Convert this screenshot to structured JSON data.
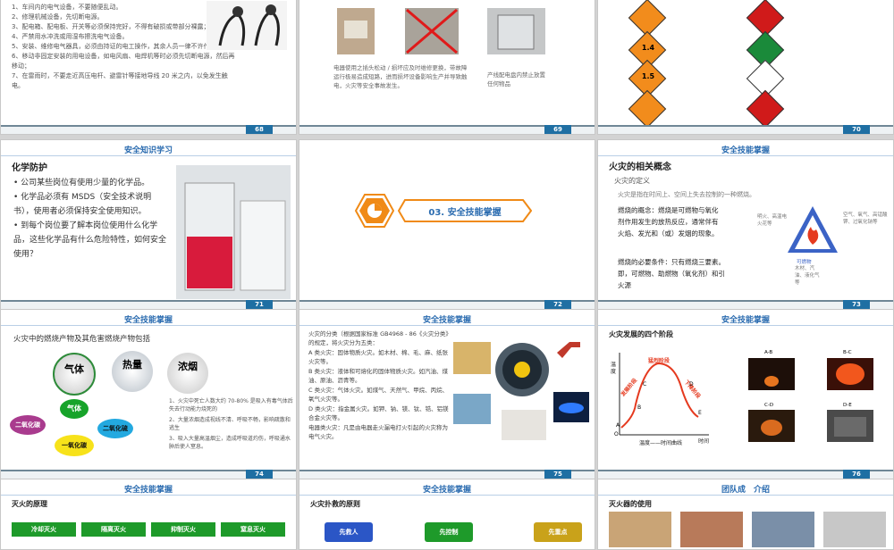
{
  "slide68": {
    "page": "68",
    "lines": [
      "1、车间内的电气设备，不要随便乱动。",
      "2、修理机械设备，先切断电源。",
      "3、配电箱、配电板、开关等必须保持完好，不得有破损或带部分裸露；",
      "4、严禁用水冲洗或用湿布擦洗电气设备。",
      "5、安装、维修电气器具，必须由持证的电工操作，其余人员一律不许作业。",
      "6、移动非固定安装的用电设备，如电风扇、电焊机等时必须先切断电源，然后再移动；",
      "7、在雷雨时，不要走近高压电杆、避雷针等接地导线 20 米之内，以免发生触电。"
    ]
  },
  "slide69": {
    "page": "69",
    "caption_left": "电器使用之插头松动 / 损坏应及时维修更换，带故障运行极易造成短路，进而损坏设备影响生产并导致触电，火灾等安全事故发生。",
    "caption_right": "产线配电盘内禁止放置任何物品"
  },
  "slide70": {
    "page": "70",
    "labels": [
      "1.4",
      "1.5",
      "1.6"
    ]
  },
  "slide71": {
    "page": "71",
    "header": "安全知识学习",
    "title": "化学防护",
    "bullets": [
      "公司某些岗位有使用少量的化学品。",
      "化学品必须有 MSDS（安全技术说明书），使用者必须保持安全使用知识。",
      "到每个岗位要了解本岗位使用什么化学品，这些化学品有什么危险特性，如何安全使用？"
    ]
  },
  "slide72": {
    "page": "72",
    "section": "03. 安全技能掌握"
  },
  "slide73": {
    "page": "73",
    "header": "安全技能掌握",
    "title": "火灾的相关概念",
    "subtitle": "火灾的定义",
    "def": "火灾是指在时间上、空间上失去控制的一种燃烧。",
    "concept": "燃烧的概念：燃烧是可燃物与氧化剂作用发生的放热反应，通常伴有火焰、发光和（或）发烟的现象。",
    "cond": "燃烧的必要条件：只有燃烧三要素。即，可燃物、助燃物（氧化剂）和引火源",
    "tri_left": "明火、高温电火花等",
    "tri_right": "空气、氧气、高锰酸钾、过氧化钠等",
    "tri_bottom": "可燃物",
    "tri_bottom2": "木材、汽油、液化气等"
  },
  "slide74": {
    "page": "74",
    "header": "安全技能掌握",
    "title": "火灾中的燃烧产物及其危害燃烧产物包括",
    "c1": "气体",
    "c2": "热量",
    "c3": "浓烟",
    "gas": "气体",
    "co2": "二氧化碳",
    "so2": "二氧化硫",
    "co": "一氧化碳",
    "notes": [
      "1、火灾中死亡人数大约 70-80% 是吸入有毒气体后失去行动能力烧死的",
      "2、大量浓烟造成视线不清、呼吸不畅，影响疏散和逃生",
      "3、吸入大量高温烟尘，造成呼吸道灼伤，呼吸通水肿后使人窒息。"
    ]
  },
  "slide75": {
    "page": "75",
    "header": "安全技能掌握",
    "lines": [
      "火灾的分类（根据国家标准 GB4968 - 86《火灾分类》的规定，将火灾分为五类：",
      "A 类火灾：固体物质火灾。如木材、棉、毛、麻、纸张火灾等。",
      "B 类火灾：液体和可熔化的固体物质火灾。如汽油、煤油、原油、沥青等。",
      "C 类火灾：气体火灾。如煤气、天然气、甲烷、丙烷、氧气火灾等。",
      "D 类火灾：指金属火灾。如钾、钠、镁、钛、锆、铝镁合金火灾等。",
      "电器类火灾：凡是由电器走火漏电打火引起的火灾称为电气火灾。"
    ]
  },
  "slide76": {
    "page": "76",
    "header": "安全技能掌握",
    "title": "火灾发展的四个阶段",
    "ylabel": "温度",
    "xlabel": "温度——时间曲线",
    "xend": "时间",
    "origin": "O",
    "peak": "猛烈阶段",
    "rise": "发展阶段",
    "fall": "下降阶段",
    "pA": "A",
    "pB": "B",
    "pC": "C",
    "pD": "D",
    "pE": "E",
    "img_labels": [
      "A-B",
      "B-C",
      "C-D",
      "D-E"
    ]
  },
  "slide77": {
    "header": "安全技能掌握",
    "title": "灭火的原理",
    "steps": [
      "冷却灭火",
      "隔离灭火",
      "抑制灭火",
      "窒息灭火"
    ]
  },
  "slide78": {
    "header": "安全技能掌握",
    "title": "火灾扑救的原则",
    "steps": [
      "先救人",
      "先控制",
      "先重点"
    ]
  },
  "slide79": {
    "header": "团队成　介绍",
    "title": "灭火器的使用"
  }
}
